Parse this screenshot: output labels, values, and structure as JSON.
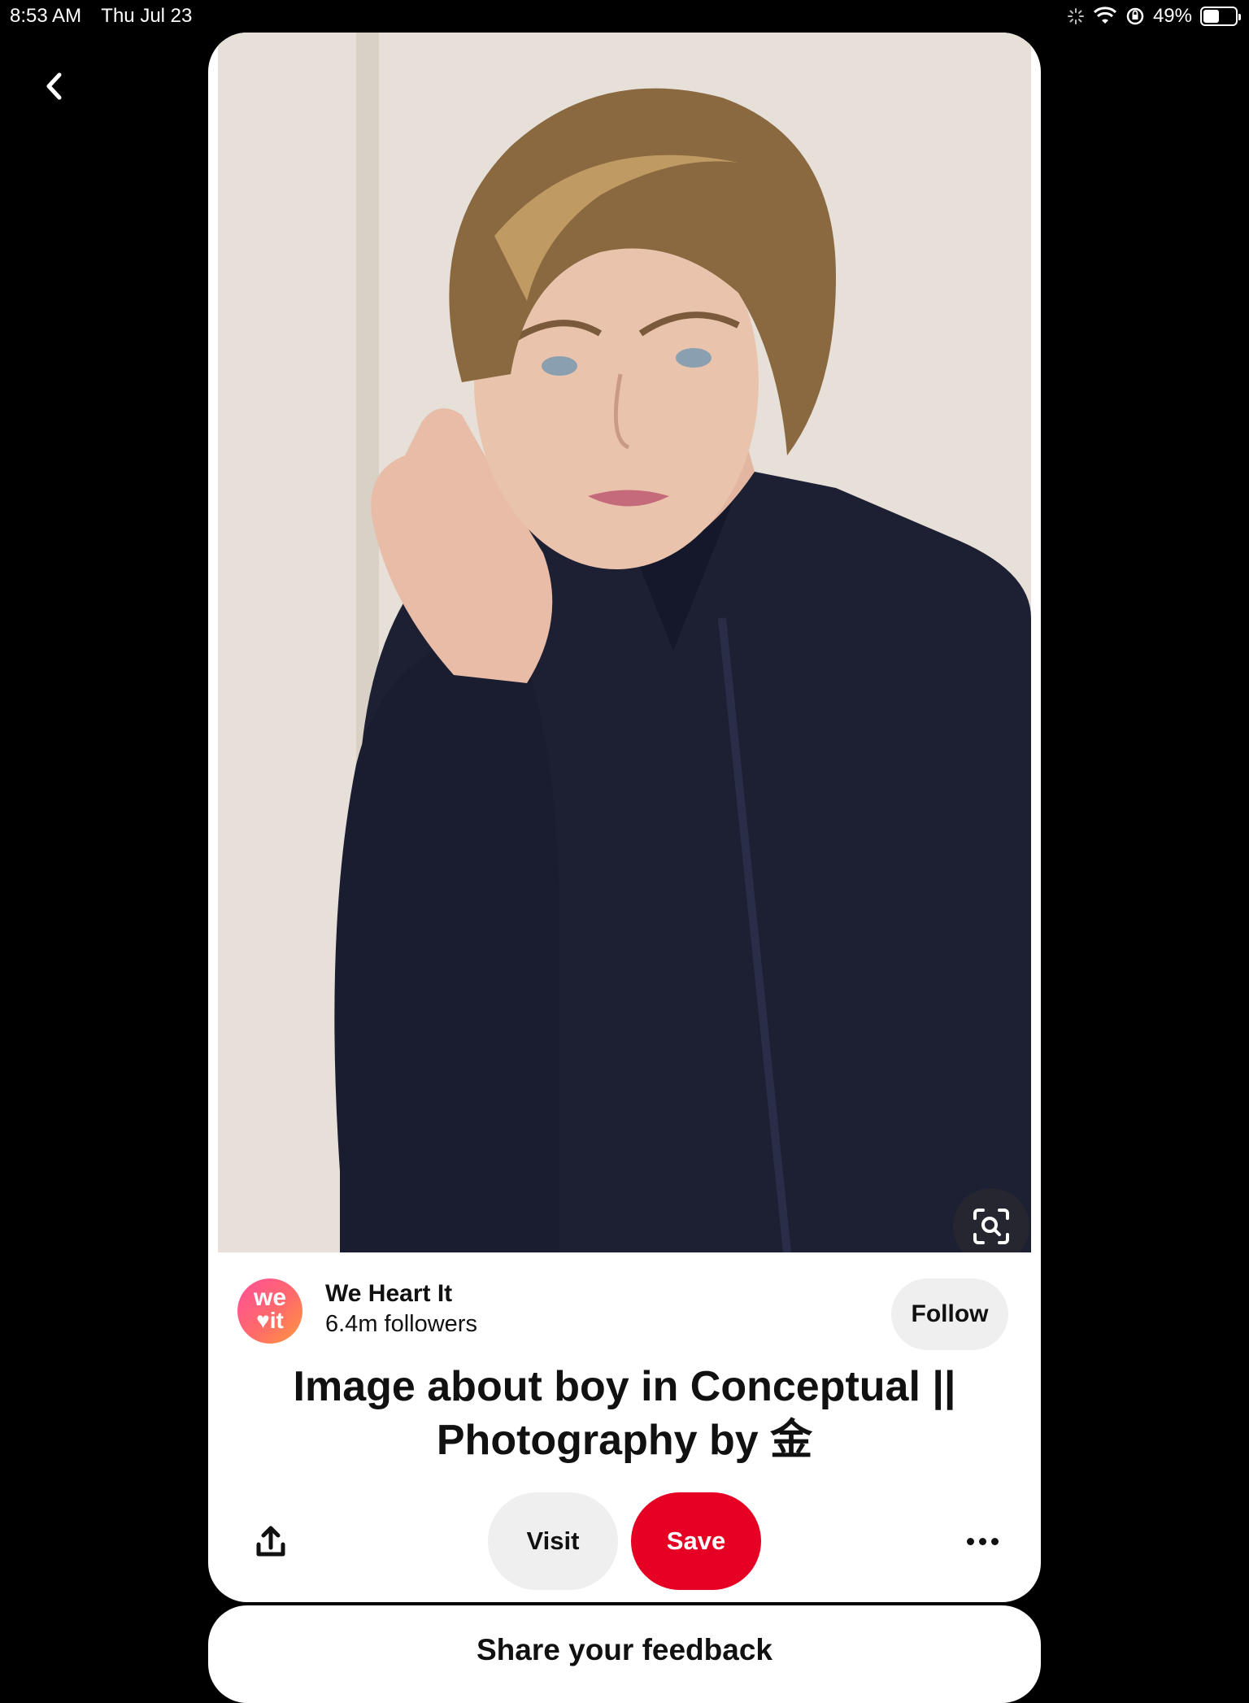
{
  "status_bar": {
    "time": "8:53 AM",
    "date": "Thu Jul 23",
    "battery": "49%",
    "battery_level": 0.49
  },
  "navigation": {
    "back_icon": "chevron-left-icon"
  },
  "pin": {
    "image_subject": "photo-portrait",
    "creator": {
      "avatar_line1": "we",
      "avatar_line2": "♥it",
      "name": "We Heart It",
      "followers": "6.4m followers",
      "follow_label": "Follow"
    },
    "title": "Image about boy in Conceptual || Photography by 金",
    "actions": {
      "share_icon": "share-icon",
      "visit_label": "Visit",
      "save_label": "Save",
      "more_icon": "more-icon"
    }
  },
  "feedback": {
    "title": "Share your feedback"
  },
  "colors": {
    "save_red": "#e60023",
    "button_gray": "#efefef",
    "background": "#000000",
    "card": "#ffffff"
  }
}
